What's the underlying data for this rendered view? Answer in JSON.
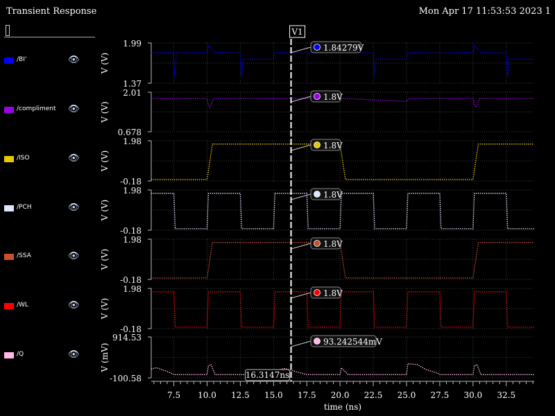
{
  "window": {
    "title": "Transient Response",
    "datetime": "Mon Apr 17 11:53:53 2023  1"
  },
  "marker": {
    "label": "V1",
    "time_readout": "16.3147ns"
  },
  "legend": [
    {
      "label": "/BI'",
      "color": "#0000ff"
    },
    {
      "label": "/compliment",
      "color": "#9b00e8"
    },
    {
      "label": "/ISO",
      "color": "#e6c800"
    },
    {
      "label": "/PCH",
      "color": "#dde8ff"
    },
    {
      "label": "/SSA",
      "color": "#c8502d"
    },
    {
      "label": "/WL",
      "color": "#ff0000"
    },
    {
      "label": "/Q",
      "color": "#ffb8e8"
    }
  ],
  "icons": {
    "visibility": "eye-icon"
  },
  "chart_data": {
    "type": "line",
    "xlabel": "time (ns)",
    "xlim": [
      5.8,
      34.6
    ],
    "x_ticks": [
      "7.5",
      "10.0",
      "12.5",
      "15.0",
      "17.5",
      "20.0",
      "22.5",
      "25.0",
      "27.5",
      "30.0",
      "32.5"
    ],
    "grid": true,
    "cursor_x": 16.3147,
    "panels": [
      {
        "name": "/BI'",
        "color": "#0000ff",
        "ylabel": "V (V)",
        "ytop": "1.99",
        "ybottom": "1.37",
        "ylim": [
          1.37,
          1.99
        ],
        "readout": "1.84279V",
        "x": [
          5.8,
          7.45,
          7.55,
          7.7,
          10.0,
          10.1,
          10.6,
          12.5,
          12.6,
          12.7,
          15.0,
          15.1,
          20.0,
          20.1,
          20.6,
          22.5,
          22.6,
          22.7,
          25.0,
          25.1,
          30.0,
          30.1,
          30.6,
          32.5,
          32.6,
          32.7,
          34.6
        ],
        "y": [
          1.84,
          1.84,
          1.47,
          1.84,
          1.84,
          1.95,
          1.84,
          1.84,
          1.47,
          1.74,
          1.74,
          1.84,
          1.84,
          1.95,
          1.84,
          1.84,
          1.47,
          1.74,
          1.74,
          1.84,
          1.84,
          1.95,
          1.84,
          1.84,
          1.47,
          1.74,
          1.74
        ]
      },
      {
        "name": "/compliment",
        "color": "#9b00e8",
        "ylabel": "V (V)",
        "ytop": "2.01",
        "ybottom": "0.678",
        "ylim": [
          0.678,
          2.01
        ],
        "readout": "1.8V",
        "x": [
          5.8,
          10.0,
          10.1,
          10.2,
          10.5,
          20.0,
          20.2,
          25.0,
          25.2,
          30.0,
          30.1,
          30.2,
          30.5,
          34.6
        ],
        "y": [
          1.8,
          1.8,
          1.6,
          1.5,
          1.8,
          1.8,
          1.8,
          1.7,
          1.8,
          1.8,
          1.6,
          1.5,
          1.8,
          1.8
        ]
      },
      {
        "name": "/ISO",
        "color": "#e6c800",
        "ylabel": "V (V)",
        "ytop": "1.98",
        "ybottom": "-0.18",
        "ylim": [
          -0.18,
          1.98
        ],
        "readout": "1.8V",
        "x": [
          5.8,
          10.0,
          10.4,
          20.0,
          20.4,
          30.0,
          30.4,
          34.6
        ],
        "y": [
          -0.1,
          -0.1,
          1.8,
          1.8,
          -0.1,
          -0.1,
          1.8,
          1.8
        ]
      },
      {
        "name": "/PCH",
        "color": "#dde8ff",
        "ylabel": "V (V)",
        "ytop": "1.98",
        "ybottom": "-0.18",
        "ylim": [
          -0.18,
          1.98
        ],
        "readout": "1.8V",
        "x": [
          5.8,
          7.5,
          7.6,
          10.0,
          10.1,
          12.5,
          12.6,
          15.0,
          15.1,
          17.5,
          17.6,
          20.0,
          20.1,
          22.5,
          22.6,
          25.0,
          25.1,
          27.5,
          27.6,
          30.0,
          30.1,
          32.5,
          32.6,
          34.6
        ],
        "y": [
          1.8,
          1.8,
          -0.1,
          -0.1,
          1.8,
          1.8,
          -0.1,
          -0.1,
          1.8,
          1.8,
          -0.1,
          -0.1,
          1.8,
          1.8,
          -0.1,
          -0.1,
          1.8,
          1.8,
          -0.1,
          -0.1,
          1.8,
          1.8,
          -0.1,
          -0.1
        ]
      },
      {
        "name": "/SSA",
        "color": "#c8502d",
        "ylabel": "V (V)",
        "ytop": "1.98",
        "ybottom": "-0.18",
        "ylim": [
          -0.18,
          1.98
        ],
        "readout": "1.8V",
        "x": [
          5.8,
          10.0,
          10.4,
          20.0,
          20.4,
          30.0,
          30.4,
          34.6
        ],
        "y": [
          -0.1,
          -0.1,
          1.8,
          1.8,
          -0.1,
          -0.1,
          1.8,
          1.8
        ]
      },
      {
        "name": "/WL",
        "color": "#ff0000",
        "ylabel": "V (V)",
        "ytop": "1.98",
        "ybottom": "-0.18",
        "ylim": [
          -0.18,
          1.98
        ],
        "readout": "1.8V",
        "x": [
          5.8,
          7.5,
          7.6,
          10.0,
          10.1,
          12.5,
          12.6,
          15.0,
          15.1,
          17.5,
          17.6,
          20.0,
          20.1,
          22.5,
          22.6,
          25.0,
          25.1,
          27.5,
          27.6,
          30.0,
          30.1,
          32.5,
          32.6,
          34.6
        ],
        "y": [
          1.8,
          1.8,
          -0.1,
          -0.1,
          1.8,
          1.8,
          -0.1,
          -0.1,
          1.8,
          1.8,
          -0.1,
          -0.1,
          1.8,
          1.8,
          -0.1,
          -0.1,
          1.8,
          1.8,
          -0.1,
          -0.1,
          1.8,
          1.8,
          -0.1,
          -0.1
        ]
      },
      {
        "name": "/Q",
        "color": "#ffb8e8",
        "ylabel": "V (mV)",
        "ytop": "914.53",
        "ybottom": "-100.58",
        "ylim": [
          -100.58,
          914.53
        ],
        "readout": "93.242544mV",
        "x": [
          5.8,
          6.2,
          7.0,
          7.5,
          10.0,
          10.1,
          10.3,
          10.6,
          15.0,
          15.1,
          15.8,
          16.3,
          16.6,
          17.5,
          20.0,
          20.1,
          20.6,
          25.0,
          25.1,
          25.8,
          26.5,
          27.3,
          27.5,
          30.0,
          30.1,
          30.3,
          30.6,
          34.6
        ],
        "y": [
          120,
          150,
          60,
          -20,
          -20,
          200,
          230,
          -20,
          -20,
          80,
          130,
          93,
          60,
          -20,
          -20,
          150,
          -20,
          -20,
          250,
          230,
          100,
          20,
          -20,
          -20,
          200,
          230,
          -20,
          -20
        ]
      }
    ]
  }
}
